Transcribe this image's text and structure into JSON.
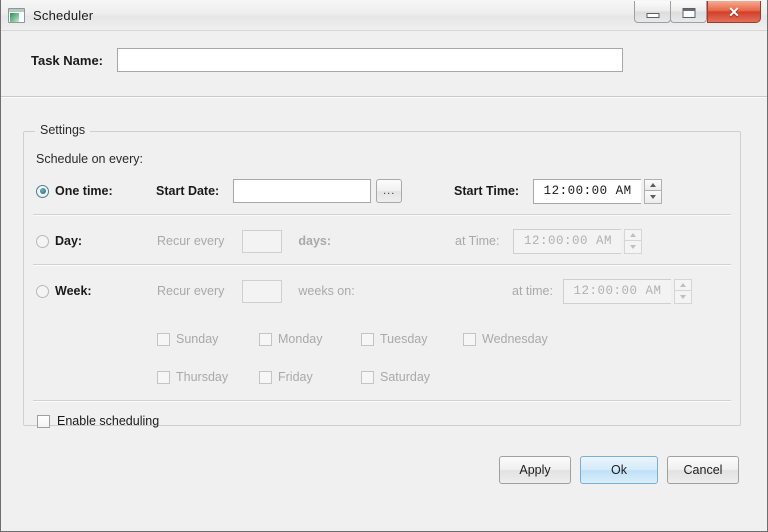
{
  "window": {
    "title": "Scheduler",
    "icon": "app-window-icon",
    "controls": {
      "minimize": "minimize-button",
      "maximize": "maximize-button",
      "close_glyph": "✕"
    }
  },
  "task": {
    "label": "Task Name:",
    "value": "",
    "placeholder": ""
  },
  "settings": {
    "group_title": "Settings",
    "schedule_label": "Schedule on every:",
    "one_time": {
      "radio_label": "One time:",
      "selected": true,
      "start_date_label": "Start Date:",
      "start_date_value": "",
      "browse_label": "...",
      "start_time_label": "Start Time:",
      "start_time_value": "12:00:00 AM"
    },
    "day": {
      "radio_label": "Day:",
      "selected": false,
      "recur_label": "Recur every",
      "recur_value": "",
      "unit_label": "days:",
      "time_label": "at Time:",
      "time_value": "12:00:00 AM"
    },
    "week": {
      "radio_label": "Week:",
      "selected": false,
      "recur_label": "Recur every",
      "recur_value": "",
      "unit_label": "weeks on:",
      "time_label": "at time:",
      "time_value": "12:00:00 AM",
      "days": [
        {
          "label": "Sunday",
          "checked": false
        },
        {
          "label": "Monday",
          "checked": false
        },
        {
          "label": "Tuesday",
          "checked": false
        },
        {
          "label": "Wednesday",
          "checked": false
        },
        {
          "label": "Thursday",
          "checked": false
        },
        {
          "label": "Friday",
          "checked": false
        },
        {
          "label": "Saturday",
          "checked": false
        }
      ]
    },
    "enable": {
      "label": "Enable scheduling",
      "checked": false
    }
  },
  "footer": {
    "apply_label": "Apply",
    "ok_label": "Ok",
    "cancel_label": "Cancel"
  },
  "colors": {
    "dialog_bg": "#f0f0f0",
    "accent_default_button": "#bfe0f7",
    "close_button": "#d4402a",
    "radio_selected": "#2f7a96",
    "disabled_text": "#a9a9a9"
  }
}
